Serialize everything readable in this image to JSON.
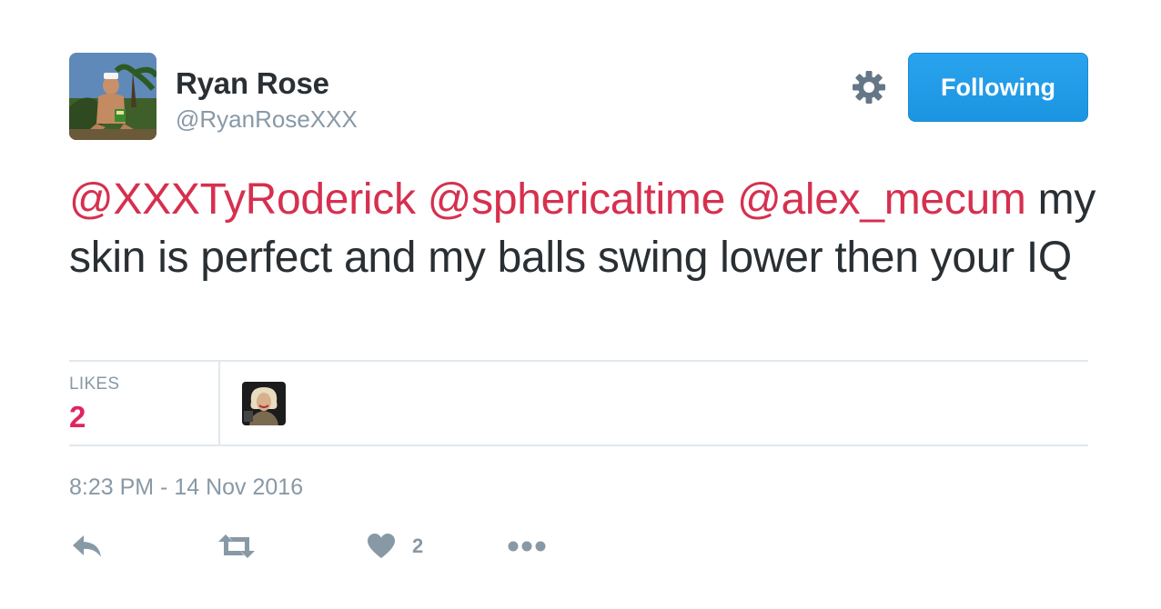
{
  "user": {
    "name": "Ryan Rose",
    "handle": "@RyanRoseXXX",
    "follow_label": "Following"
  },
  "tweet": {
    "mentions": [
      "@XXXTyRoderick",
      "@sphericaltime",
      "@alex_mecum"
    ],
    "body": "my skin is perfect and my balls swing lower then your IQ"
  },
  "stats": {
    "likes_label": "LIKES",
    "likes_count": "2"
  },
  "timestamp": "8:23 PM - 14 Nov 2016",
  "actions": {
    "like_count": "2"
  },
  "colors": {
    "accent": "#1b95e0",
    "mention": "#d6304f",
    "muted": "#8899a6",
    "text": "#292f33"
  },
  "icons": {
    "settings": "gear-icon",
    "reply": "reply-icon",
    "retweet": "retweet-icon",
    "like": "heart-icon",
    "more": "more-dots-icon"
  }
}
